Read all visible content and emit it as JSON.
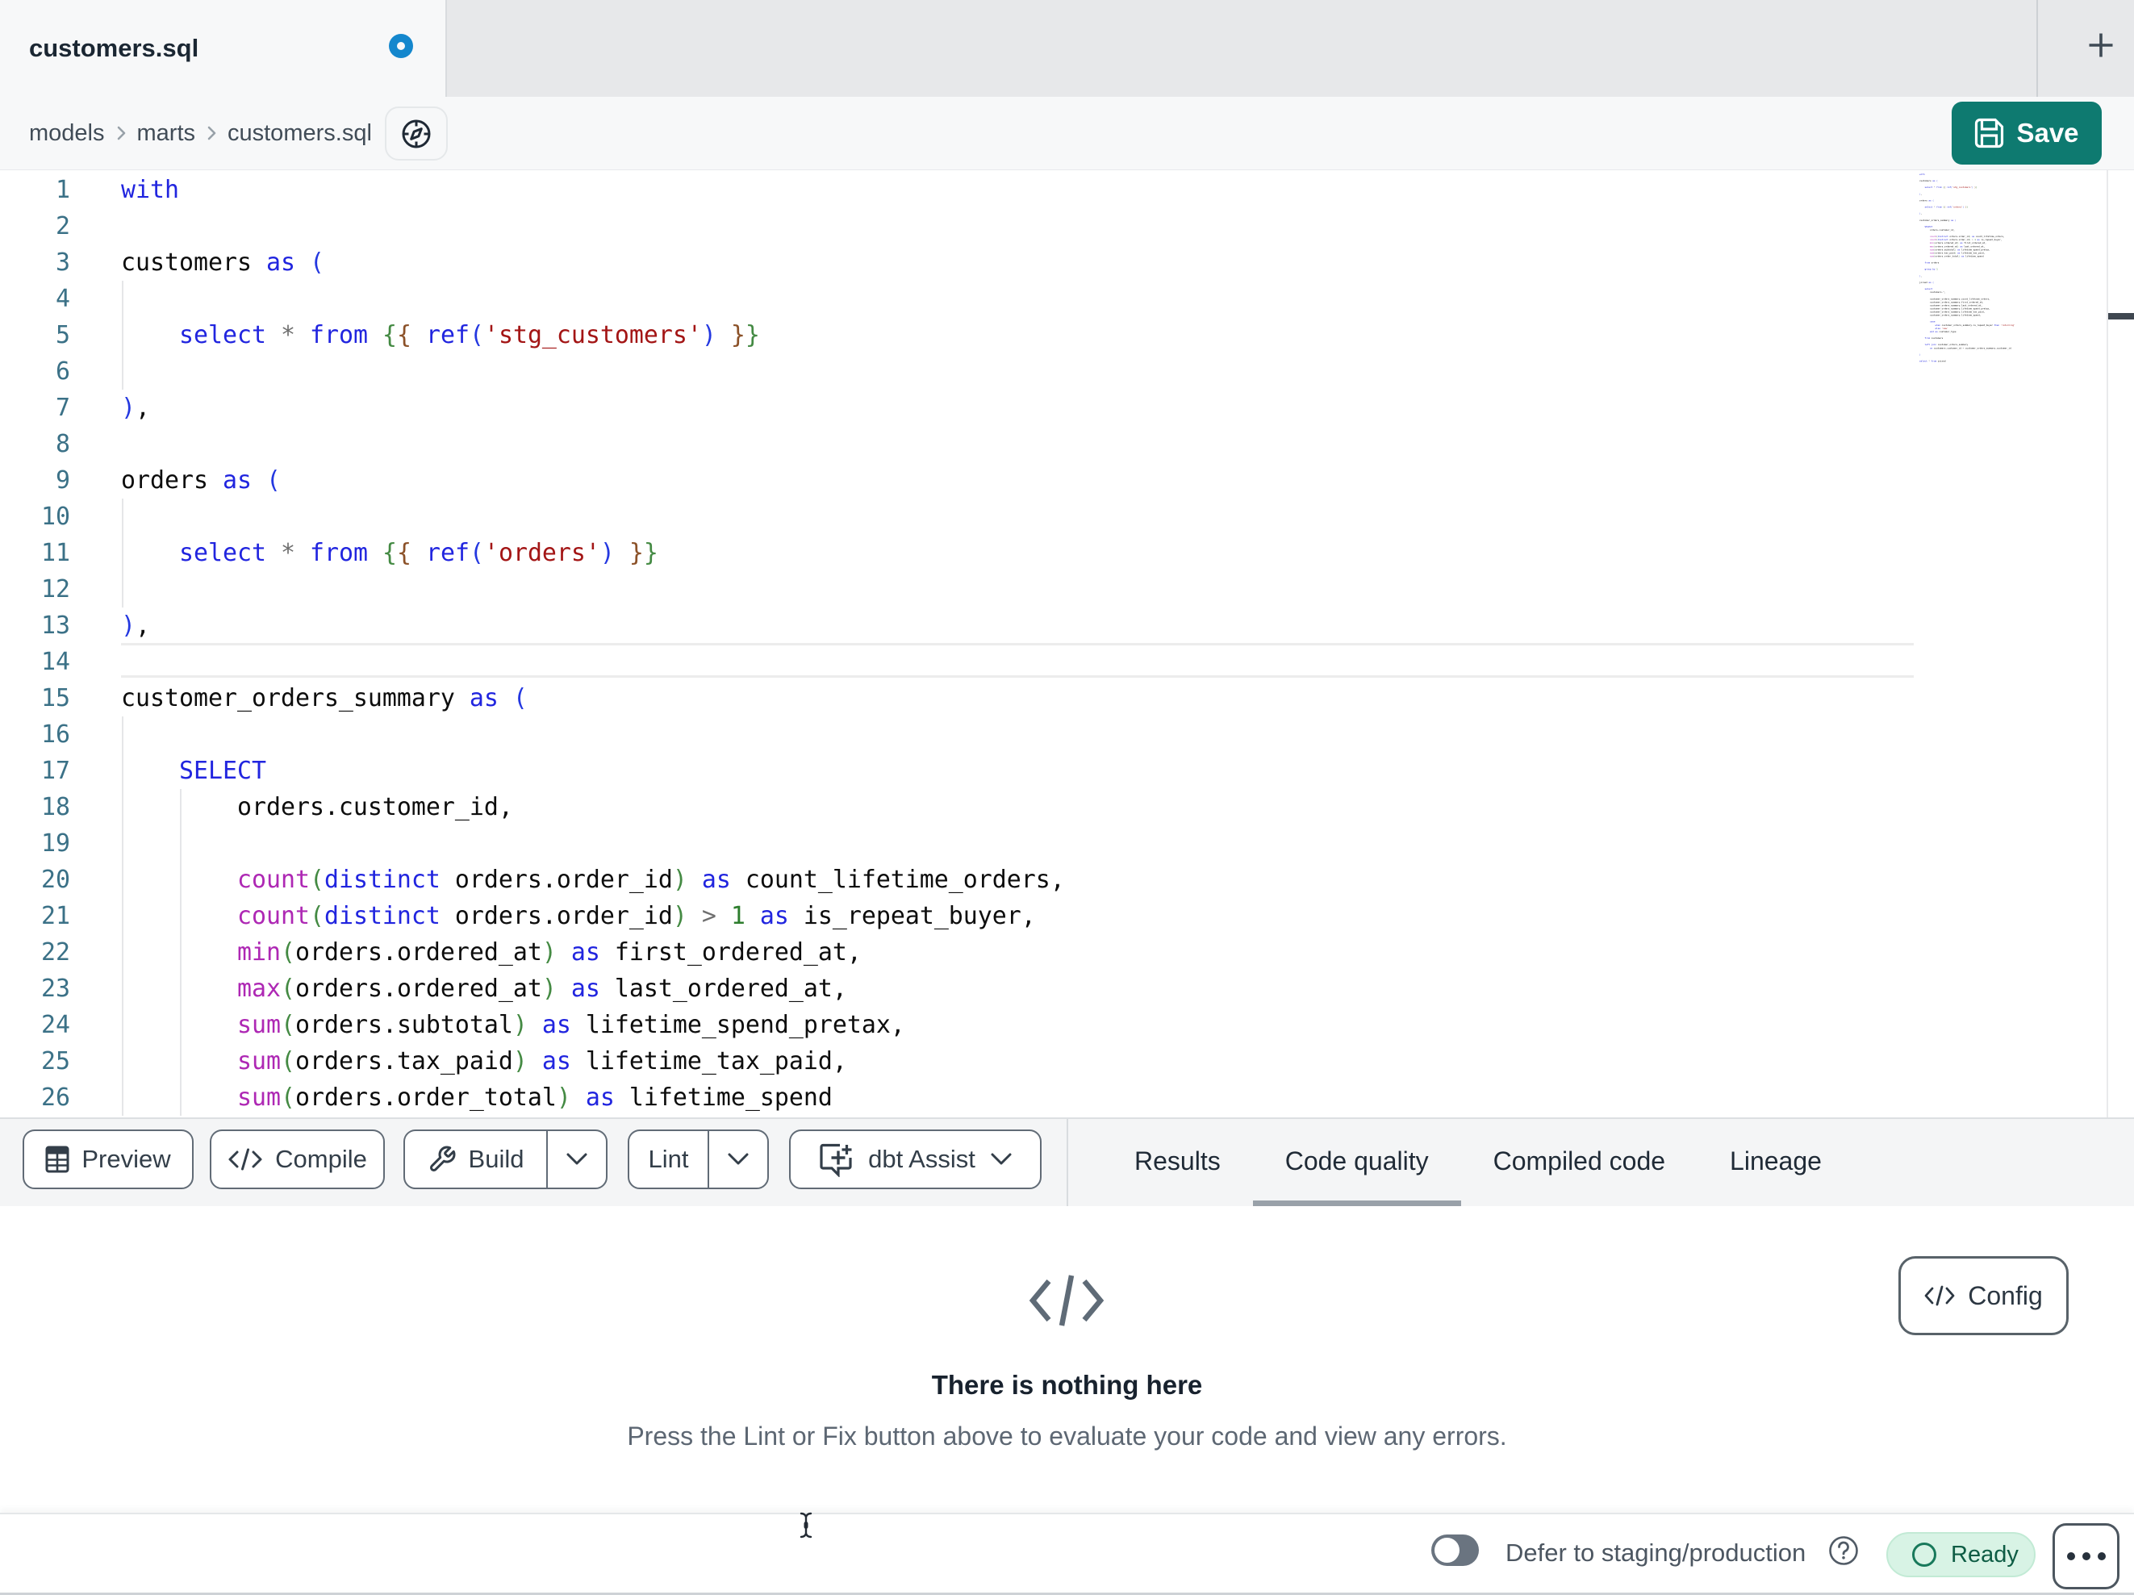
{
  "tab_bar": {
    "title": "customers.sql",
    "unsaved_dot": "blue-dot",
    "new_tab_button": "+"
  },
  "breadcrumb": {
    "items": [
      "models",
      "marts",
      "customers.sql"
    ],
    "separator": "›"
  },
  "save_button": {
    "label": "Save"
  },
  "editor": {
    "active_line": 14,
    "font": "monospace",
    "lines": [
      {
        "n": 1,
        "seg": [
          [
            "k",
            "with"
          ]
        ]
      },
      {
        "n": 2,
        "seg": []
      },
      {
        "n": 3,
        "seg": [
          [
            "t",
            "customers "
          ],
          [
            "k",
            "as"
          ],
          [
            "t",
            " "
          ],
          [
            "p1",
            "("
          ]
        ]
      },
      {
        "n": 4,
        "seg": []
      },
      {
        "n": 5,
        "seg": [
          [
            "t",
            "    "
          ],
          [
            "k",
            "select"
          ],
          [
            "t",
            " "
          ],
          [
            "o",
            "*"
          ],
          [
            "t",
            " "
          ],
          [
            "k",
            "from"
          ],
          [
            "t",
            " "
          ],
          [
            "p2",
            "{"
          ],
          [
            "p3",
            "{"
          ],
          [
            "t",
            " "
          ],
          [
            "k",
            "ref"
          ],
          [
            "p1",
            "("
          ],
          [
            "s",
            "'stg_customers'"
          ],
          [
            "p1",
            ")"
          ],
          [
            "t",
            " "
          ],
          [
            "p3",
            "}"
          ],
          [
            "p2",
            "}"
          ]
        ]
      },
      {
        "n": 6,
        "seg": []
      },
      {
        "n": 7,
        "seg": [
          [
            "p1",
            ")"
          ],
          [
            "t",
            ","
          ]
        ]
      },
      {
        "n": 8,
        "seg": []
      },
      {
        "n": 9,
        "seg": [
          [
            "t",
            "orders "
          ],
          [
            "k",
            "as"
          ],
          [
            "t",
            " "
          ],
          [
            "p1",
            "("
          ]
        ]
      },
      {
        "n": 10,
        "seg": []
      },
      {
        "n": 11,
        "seg": [
          [
            "t",
            "    "
          ],
          [
            "k",
            "select"
          ],
          [
            "t",
            " "
          ],
          [
            "o",
            "*"
          ],
          [
            "t",
            " "
          ],
          [
            "k",
            "from"
          ],
          [
            "t",
            " "
          ],
          [
            "p2",
            "{"
          ],
          [
            "p3",
            "{"
          ],
          [
            "t",
            " "
          ],
          [
            "k",
            "ref"
          ],
          [
            "p1",
            "("
          ],
          [
            "s",
            "'orders'"
          ],
          [
            "p1",
            ")"
          ],
          [
            "t",
            " "
          ],
          [
            "p3",
            "}"
          ],
          [
            "p2",
            "}"
          ]
        ]
      },
      {
        "n": 12,
        "seg": []
      },
      {
        "n": 13,
        "seg": [
          [
            "p1",
            ")"
          ],
          [
            "t",
            ","
          ]
        ]
      },
      {
        "n": 14,
        "seg": []
      },
      {
        "n": 15,
        "seg": [
          [
            "t",
            "customer_orders_summary "
          ],
          [
            "k",
            "as"
          ],
          [
            "t",
            " "
          ],
          [
            "p1",
            "("
          ]
        ]
      },
      {
        "n": 16,
        "seg": []
      },
      {
        "n": 17,
        "seg": [
          [
            "t",
            "    "
          ],
          [
            "k",
            "SELECT"
          ]
        ]
      },
      {
        "n": 18,
        "seg": [
          [
            "t",
            "        orders.customer_id,"
          ]
        ]
      },
      {
        "n": 19,
        "seg": []
      },
      {
        "n": 20,
        "seg": [
          [
            "t",
            "        "
          ],
          [
            "b",
            "count"
          ],
          [
            "p2",
            "("
          ],
          [
            "k",
            "distinct"
          ],
          [
            "t",
            " orders.order_id"
          ],
          [
            "p2",
            ")"
          ],
          [
            "t",
            " "
          ],
          [
            "k",
            "as"
          ],
          [
            "t",
            " count_lifetime_orders,"
          ]
        ]
      },
      {
        "n": 21,
        "seg": [
          [
            "t",
            "        "
          ],
          [
            "b",
            "count"
          ],
          [
            "p2",
            "("
          ],
          [
            "k",
            "distinct"
          ],
          [
            "t",
            " orders.order_id"
          ],
          [
            "p2",
            ")"
          ],
          [
            "t",
            " "
          ],
          [
            "o",
            ">"
          ],
          [
            "t",
            " "
          ],
          [
            "n",
            "1"
          ],
          [
            "t",
            " "
          ],
          [
            "k",
            "as"
          ],
          [
            "t",
            " is_repeat_buyer,"
          ]
        ]
      },
      {
        "n": 22,
        "seg": [
          [
            "t",
            "        "
          ],
          [
            "b",
            "min"
          ],
          [
            "p2",
            "("
          ],
          [
            "t",
            "orders.ordered_at"
          ],
          [
            "p2",
            ")"
          ],
          [
            "t",
            " "
          ],
          [
            "k",
            "as"
          ],
          [
            "t",
            " first_ordered_at,"
          ]
        ]
      },
      {
        "n": 23,
        "seg": [
          [
            "t",
            "        "
          ],
          [
            "b",
            "max"
          ],
          [
            "p2",
            "("
          ],
          [
            "t",
            "orders.ordered_at"
          ],
          [
            "p2",
            ")"
          ],
          [
            "t",
            " "
          ],
          [
            "k",
            "as"
          ],
          [
            "t",
            " last_ordered_at,"
          ]
        ]
      },
      {
        "n": 24,
        "seg": [
          [
            "t",
            "        "
          ],
          [
            "b",
            "sum"
          ],
          [
            "p2",
            "("
          ],
          [
            "t",
            "orders.subtotal"
          ],
          [
            "p2",
            ")"
          ],
          [
            "t",
            " "
          ],
          [
            "k",
            "as"
          ],
          [
            "t",
            " lifetime_spend_pretax,"
          ]
        ]
      },
      {
        "n": 25,
        "seg": [
          [
            "t",
            "        "
          ],
          [
            "b",
            "sum"
          ],
          [
            "p2",
            "("
          ],
          [
            "t",
            "orders.tax_paid"
          ],
          [
            "p2",
            ")"
          ],
          [
            "t",
            " "
          ],
          [
            "k",
            "as"
          ],
          [
            "t",
            " lifetime_tax_paid,"
          ]
        ]
      },
      {
        "n": 26,
        "seg": [
          [
            "t",
            "        "
          ],
          [
            "b",
            "sum"
          ],
          [
            "p2",
            "("
          ],
          [
            "t",
            "orders.order_total"
          ],
          [
            "p2",
            ")"
          ],
          [
            "t",
            " "
          ],
          [
            "k",
            "as"
          ],
          [
            "t",
            " lifetime_spend"
          ]
        ]
      }
    ],
    "indent_guides": [
      {
        "col": 0,
        "from": 4,
        "to": 6
      },
      {
        "col": 0,
        "from": 10,
        "to": 12
      },
      {
        "col": 0,
        "from": 16,
        "to": 26
      },
      {
        "col": 4,
        "from": 18,
        "to": 26
      }
    ],
    "minimap_extra_lines": [
      {
        "seg": []
      },
      {
        "seg": [
          [
            "t",
            "    "
          ],
          [
            "k",
            "from"
          ],
          [
            "t",
            " orders"
          ]
        ]
      },
      {
        "seg": []
      },
      {
        "seg": [
          [
            "t",
            "    "
          ],
          [
            "k",
            "group by"
          ],
          [
            "t",
            " "
          ],
          [
            "n",
            "1"
          ]
        ]
      },
      {
        "seg": []
      },
      {
        "seg": [
          [
            "p1",
            ")"
          ],
          [
            "t",
            ","
          ]
        ]
      },
      {
        "seg": []
      },
      {
        "seg": [
          [
            "t",
            "joined "
          ],
          [
            "k",
            "as"
          ],
          [
            "t",
            " "
          ],
          [
            "p1",
            "("
          ]
        ]
      },
      {
        "seg": []
      },
      {
        "seg": [
          [
            "t",
            "    "
          ],
          [
            "k",
            "select"
          ]
        ]
      },
      {
        "seg": [
          [
            "t",
            "        customers."
          ],
          [
            "o",
            "*"
          ],
          [
            "t",
            ","
          ]
        ]
      },
      {
        "seg": []
      },
      {
        "seg": [
          [
            "t",
            "        customer_orders_summary.count_lifetime_orders,"
          ]
        ]
      },
      {
        "seg": [
          [
            "t",
            "        customer_orders_summary.first_ordered_at,"
          ]
        ]
      },
      {
        "seg": [
          [
            "t",
            "        customer_orders_summary.last_ordered_at,"
          ]
        ]
      },
      {
        "seg": [
          [
            "t",
            "        customer_orders_summary.lifetime_spend_pretax,"
          ]
        ]
      },
      {
        "seg": [
          [
            "t",
            "        customer_orders_summary.lifetime_tax_paid,"
          ]
        ]
      },
      {
        "seg": [
          [
            "t",
            "        customer_orders_summary.lifetime_spend,"
          ]
        ]
      },
      {
        "seg": []
      },
      {
        "seg": [
          [
            "t",
            "        "
          ],
          [
            "k",
            "case"
          ]
        ]
      },
      {
        "seg": [
          [
            "t",
            "            "
          ],
          [
            "k",
            "when"
          ],
          [
            "t",
            " customer_orders_summary.is_repeat_buyer "
          ],
          [
            "k",
            "then"
          ],
          [
            "t",
            " "
          ],
          [
            "s",
            "'returning'"
          ]
        ]
      },
      {
        "seg": [
          [
            "t",
            "            "
          ],
          [
            "k",
            "else"
          ],
          [
            "t",
            " "
          ],
          [
            "s",
            "'new'"
          ]
        ]
      },
      {
        "seg": [
          [
            "t",
            "        "
          ],
          [
            "k",
            "end"
          ],
          [
            "t",
            " "
          ],
          [
            "k",
            "as"
          ],
          [
            "t",
            " customer_type"
          ]
        ]
      },
      {
        "seg": []
      },
      {
        "seg": [
          [
            "t",
            "    "
          ],
          [
            "k",
            "from"
          ],
          [
            "t",
            " customers"
          ]
        ]
      },
      {
        "seg": []
      },
      {
        "seg": [
          [
            "t",
            "    "
          ],
          [
            "k",
            "left join"
          ],
          [
            "t",
            " customer_orders_summary"
          ]
        ]
      },
      {
        "seg": [
          [
            "t",
            "        "
          ],
          [
            "k",
            "on"
          ],
          [
            "t",
            " customers.customer_id "
          ],
          [
            "o",
            "="
          ],
          [
            "t",
            " customer_orders_summary.customer_id"
          ]
        ]
      },
      {
        "seg": []
      },
      {
        "seg": [
          [
            "p1",
            ")"
          ]
        ]
      },
      {
        "seg": []
      },
      {
        "seg": [
          [
            "k",
            "select"
          ],
          [
            "t",
            " "
          ],
          [
            "o",
            "*"
          ],
          [
            "t",
            " "
          ],
          [
            "k",
            "from"
          ],
          [
            "t",
            " joined"
          ]
        ]
      }
    ]
  },
  "toolbar": {
    "preview_label": "Preview",
    "compile_label": "Compile",
    "build_label": "Build",
    "lint_label": "Lint",
    "dbt_assist_label": "dbt Assist"
  },
  "panel_tabs": {
    "results": "Results",
    "code_quality": "Code quality",
    "compiled_code": "Compiled code",
    "lineage": "Lineage",
    "active": "Code quality"
  },
  "empty_state": {
    "title": "There is nothing here",
    "subtitle": "Press the Lint or Fix button above to evaluate your code and view any errors."
  },
  "config_button": {
    "label": "Config"
  },
  "status_bar": {
    "defer_toggle_label": "Defer to staging/production",
    "defer_toggle_state": "off",
    "ready_status": "Ready"
  },
  "colors": {
    "accent_teal": "#0e7a70",
    "unsaved_dot_blue": "#1487cd",
    "ready_pill_bg": "#d8f3e5",
    "ready_text": "#0f5f45",
    "keyword": "#2125df",
    "builtin": "#ae28b4",
    "string": "#a31515",
    "number": "#2d7d2d",
    "line_number": "#3b7187"
  }
}
